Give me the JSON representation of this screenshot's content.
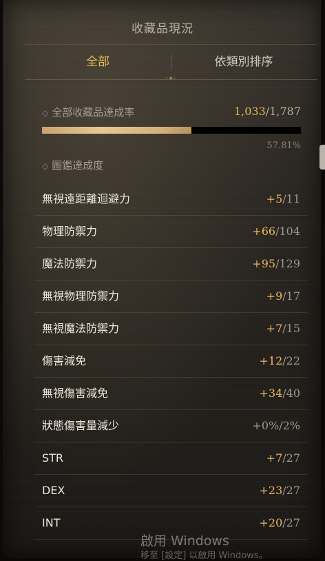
{
  "title": "收藏品現況",
  "tabs": {
    "all": "全部",
    "sort": "依類別排序"
  },
  "total": {
    "label": "全部收藏品達成率",
    "current": "1,033",
    "max": "/1,787",
    "percent_text": "57.81%",
    "progress": 0.5781
  },
  "codex_label": "圖鑑達成度",
  "stats": [
    {
      "name": "無視遠距離迴避力",
      "current": "+5",
      "max": "/11"
    },
    {
      "name": "物理防禦力",
      "current": "+66",
      "max": "/104"
    },
    {
      "name": "魔法防禦力",
      "current": "+95",
      "max": "/129"
    },
    {
      "name": "無視物理防禦力",
      "current": "+9",
      "max": "/17"
    },
    {
      "name": "無視魔法防禦力",
      "current": "+7",
      "max": "/15"
    },
    {
      "name": "傷害減免",
      "current": "+12",
      "max": "/22"
    },
    {
      "name": "無視傷害減免",
      "current": "+34",
      "max": "/40"
    },
    {
      "name": "狀態傷害量減少",
      "current": "+0%",
      "max": "/2%"
    },
    {
      "name": "STR",
      "current": "+7",
      "max": "/27"
    },
    {
      "name": "DEX",
      "current": "+23",
      "max": "/27"
    },
    {
      "name": "INT",
      "current": "+20",
      "max": "/27"
    }
  ],
  "watermark": {
    "line1": "啟用 Windows",
    "line2": "移至 [設定] 以啟用 Windows。"
  },
  "colors": {
    "accent": "#e8b658",
    "text": "#ece6da",
    "muted": "#9f988b"
  }
}
